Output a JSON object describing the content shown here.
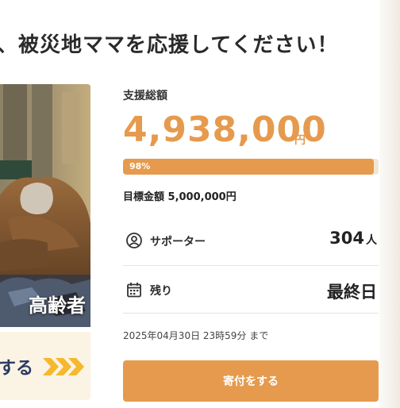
{
  "headline": "、被災地ママを応援してください！",
  "photo": {
    "caption": "高齢者"
  },
  "cta": {
    "text": "する",
    "chevron_icon": "triple-chevron-right-icon",
    "chevron_color": "#f5b82e",
    "text_color": "#2c3b63"
  },
  "funding": {
    "raised_label": "支援総額",
    "raised_amount": "4,938,000",
    "raised_unit": "円",
    "progress_percent": 98,
    "progress_label": "98%",
    "goal_text": "目標金額 5,000,000円"
  },
  "stats": {
    "supporters": {
      "icon": "person-circle-icon",
      "label": "サポーター",
      "value": "304",
      "unit": "人"
    },
    "remaining": {
      "icon": "calendar-icon",
      "label": "残り",
      "value": "最終日"
    }
  },
  "deadline_text": "2025年04月30日 23時59分 まで",
  "donate_button": "寄付をする",
  "colors": {
    "accent": "#e69a4d",
    "progress_track": "#f1e6d4",
    "cta_background": "#fbf3e4"
  }
}
